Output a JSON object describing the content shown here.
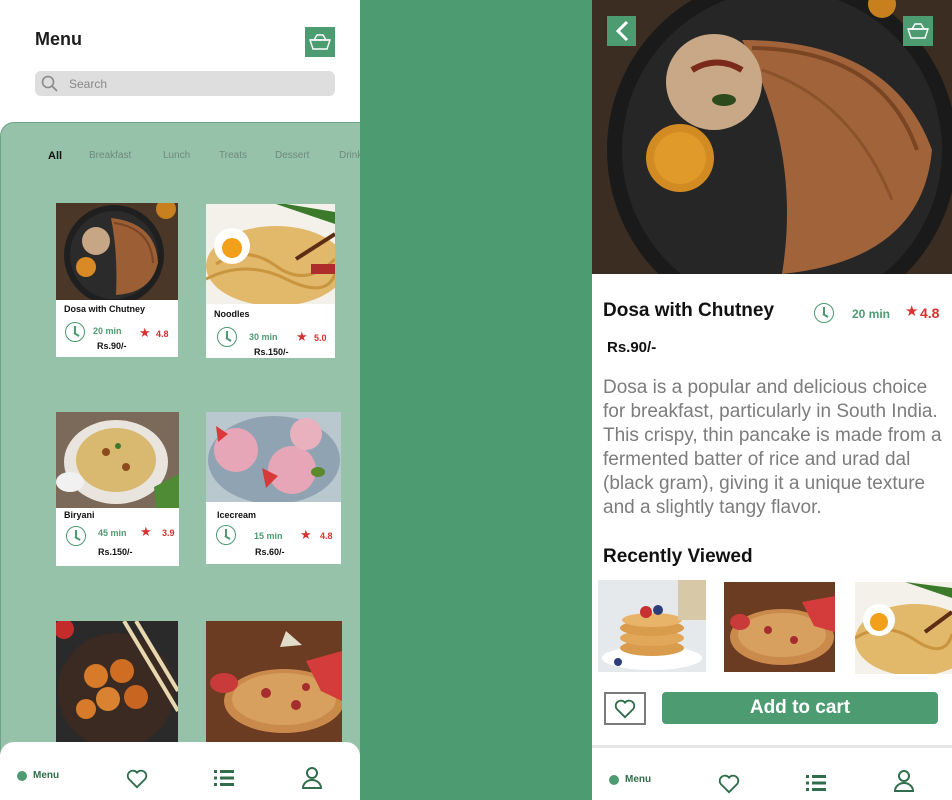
{
  "list_screen": {
    "title": "Menu",
    "search": {
      "placeholder": "Search"
    },
    "categories": [
      "All",
      "Breakfast",
      "Lunch",
      "Treats",
      "Dessert",
      "Drinks"
    ],
    "active_category": "All",
    "items": [
      {
        "name": "Dosa with Chutney",
        "time": "20 min",
        "rating": "4.8",
        "price": "Rs.90/-"
      },
      {
        "name": "Noodles",
        "time": "30 min",
        "rating": "5.0",
        "price": "Rs.150/-"
      },
      {
        "name": "Biryani",
        "time": "45 min",
        "rating": "3.9",
        "price": "Rs.150/-"
      },
      {
        "name": "Icecream",
        "time": "15 min",
        "rating": "4.8",
        "price": "Rs.60/-"
      }
    ],
    "nav": {
      "menu_label": "Menu"
    }
  },
  "detail_screen": {
    "title": "Dosa with Chutney",
    "time": "20 min",
    "rating": "4.8",
    "star": "★",
    "price": "Rs.90/-",
    "description": "Dosa is a popular and delicious choice for breakfast, particularly in South India. This crispy, thin pancake is made from a fermented batter of rice and urad dal (black gram), giving it a unique texture and a slightly tangy flavor.",
    "recent_title": "Recently Viewed",
    "add_to_cart": "Add to cart",
    "nav": {
      "menu_label": "Menu"
    }
  },
  "icons": [
    "basket-icon",
    "search-icon",
    "clock-icon",
    "star-icon",
    "heart-icon",
    "list-icon",
    "user-icon",
    "back-arrow-icon"
  ],
  "colors": {
    "brand_green": "#4c9b71",
    "panel_green": "#96c2a9",
    "rating_red": "#d93030"
  }
}
